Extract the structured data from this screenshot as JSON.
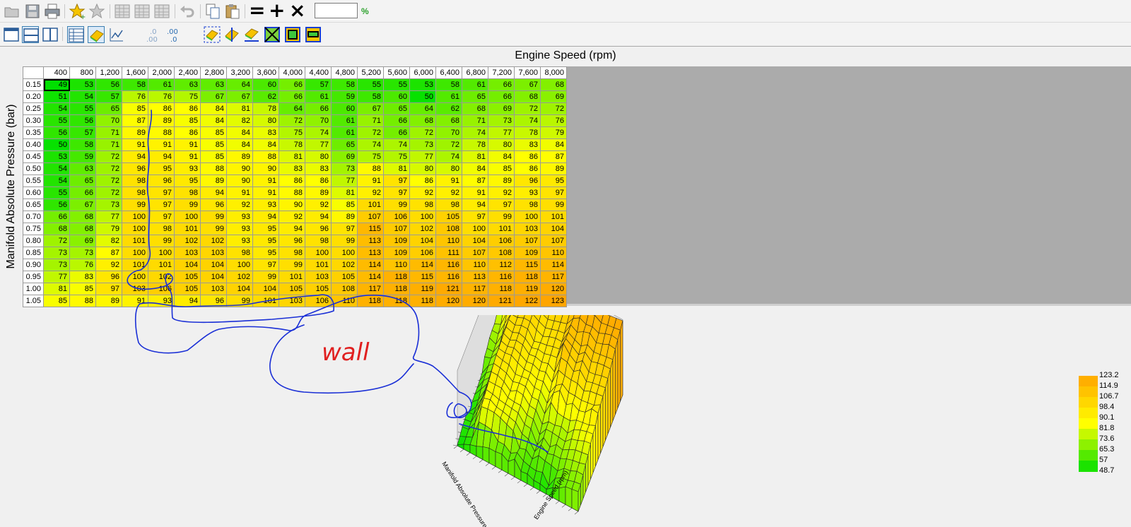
{
  "toolbar": {
    "zoom_value": "",
    "zoom_unit": "%",
    "top_icons": [
      "open-folder-icon",
      "save-icon",
      "print-icon",
      "add-favorite-icon",
      "favorite-icon",
      "table-icon-1",
      "table-icon-2",
      "table-icon-3",
      "undo-icon",
      "copy-icon",
      "paste-icon",
      "equals-icon",
      "plus-icon",
      "multiply-icon"
    ],
    "bottom_icons": [
      "single-pane-icon",
      "split-horizontal-icon",
      "split-vertical-icon",
      "table-view-icon",
      "surface-view-icon",
      "line-graph-icon",
      "decrease-decimals-icon",
      "increase-decimals-icon",
      "fill-selection-icon",
      "fill-right-icon",
      "fill-down-icon",
      "interpolate-icon",
      "interpolate-rows-icon",
      "interpolate-cols-icon"
    ],
    "equals_symbol": "=",
    "plus_symbol": "+",
    "multiply_symbol": "×"
  },
  "table": {
    "x_axis_title": "Engine Speed (rpm)",
    "y_axis_title": "Manifold Absolute Pressure (bar)",
    "columns": [
      "400",
      "800",
      "1,200",
      "1,600",
      "2,000",
      "2,400",
      "2,800",
      "3,200",
      "3,600",
      "4,000",
      "4,400",
      "4,800",
      "5,200",
      "5,600",
      "6,000",
      "6,400",
      "6,800",
      "7,200",
      "7,600",
      "8,000"
    ],
    "rows": [
      {
        "label": "0.15",
        "values": [
          49,
          53,
          56,
          58,
          61,
          63,
          63,
          64,
          60,
          66,
          57,
          58,
          55,
          55,
          53,
          58,
          61,
          66,
          67,
          68
        ]
      },
      {
        "label": "0.20",
        "values": [
          51,
          54,
          57,
          76,
          76,
          75,
          67,
          67,
          62,
          66,
          61,
          59,
          58,
          60,
          50,
          61,
          65,
          66,
          68,
          69
        ]
      },
      {
        "label": "0.25",
        "values": [
          54,
          55,
          65,
          85,
          86,
          86,
          84,
          81,
          78,
          64,
          66,
          60,
          67,
          65,
          64,
          62,
          68,
          69,
          72,
          72
        ]
      },
      {
        "label": "0.30",
        "values": [
          55,
          56,
          70,
          87,
          89,
          85,
          84,
          82,
          80,
          72,
          70,
          61,
          71,
          66,
          68,
          68,
          71,
          73,
          74,
          76
        ]
      },
      {
        "label": "0.35",
        "values": [
          56,
          57,
          71,
          89,
          88,
          86,
          85,
          84,
          83,
          75,
          74,
          61,
          72,
          66,
          72,
          70,
          74,
          77,
          78,
          79
        ]
      },
      {
        "label": "0.40",
        "values": [
          50,
          58,
          71,
          91,
          91,
          91,
          85,
          84,
          84,
          78,
          77,
          65,
          74,
          74,
          73,
          72,
          78,
          80,
          83,
          84
        ]
      },
      {
        "label": "0.45",
        "values": [
          53,
          59,
          72,
          94,
          94,
          91,
          85,
          89,
          88,
          81,
          80,
          69,
          75,
          75,
          77,
          74,
          81,
          84,
          86,
          87
        ]
      },
      {
        "label": "0.50",
        "values": [
          54,
          63,
          72,
          96,
          95,
          93,
          88,
          90,
          90,
          83,
          83,
          73,
          88,
          81,
          80,
          80,
          84,
          85,
          86,
          89
        ]
      },
      {
        "label": "0.55",
        "values": [
          54,
          65,
          72,
          98,
          96,
          95,
          89,
          90,
          91,
          86,
          86,
          77,
          91,
          97,
          86,
          91,
          87,
          89,
          96,
          95
        ]
      },
      {
        "label": "0.60",
        "values": [
          55,
          66,
          72,
          98,
          97,
          98,
          94,
          91,
          91,
          88,
          89,
          81,
          92,
          97,
          92,
          92,
          91,
          92,
          93,
          97
        ]
      },
      {
        "label": "0.65",
        "values": [
          56,
          67,
          73,
          99,
          97,
          99,
          96,
          92,
          93,
          90,
          92,
          85,
          101,
          99,
          98,
          98,
          94,
          97,
          98,
          99
        ]
      },
      {
        "label": "0.70",
        "values": [
          66,
          68,
          77,
          100,
          97,
          100,
          99,
          93,
          94,
          92,
          94,
          89,
          107,
          106,
          100,
          105,
          97,
          99,
          100,
          101
        ]
      },
      {
        "label": "0.75",
        "values": [
          68,
          68,
          79,
          100,
          98,
          101,
          99,
          93,
          95,
          94,
          96,
          97,
          115,
          107,
          102,
          108,
          100,
          101,
          103,
          104
        ]
      },
      {
        "label": "0.80",
        "values": [
          72,
          69,
          82,
          101,
          99,
          102,
          102,
          93,
          95,
          96,
          98,
          99,
          113,
          109,
          104,
          110,
          104,
          106,
          107,
          107
        ]
      },
      {
        "label": "0.85",
        "values": [
          73,
          73,
          87,
          100,
          100,
          103,
          103,
          98,
          95,
          98,
          100,
          100,
          113,
          109,
          106,
          111,
          107,
          108,
          109,
          110
        ]
      },
      {
        "label": "0.90",
        "values": [
          73,
          76,
          92,
          101,
          101,
          104,
          104,
          100,
          97,
          99,
          101,
          102,
          114,
          110,
          114,
          116,
          110,
          112,
          115,
          114
        ]
      },
      {
        "label": "0.95",
        "values": [
          77,
          83,
          96,
          100,
          102,
          105,
          104,
          102,
          99,
          101,
          103,
          105,
          114,
          118,
          115,
          116,
          113,
          116,
          118,
          117
        ]
      },
      {
        "label": "1.00",
        "values": [
          81,
          85,
          97,
          103,
          106,
          105,
          103,
          104,
          104,
          105,
          105,
          108,
          117,
          118,
          119,
          121,
          117,
          118,
          119,
          120
        ]
      },
      {
        "label": "1.05",
        "values": [
          85,
          88,
          89,
          91,
          93,
          94,
          96,
          99,
          101,
          103,
          106,
          110,
          118,
          118,
          118,
          120,
          120,
          121,
          122,
          123
        ]
      }
    ]
  },
  "graph": {
    "x_axis_title": "Engine Speed (rpm)",
    "y_axis_title": "Manifold Absolute Pressure (bar)",
    "legend_values": [
      "123.2",
      "114.9",
      "106.7",
      "98.4",
      "90.1",
      "81.8",
      "73.6",
      "65.3",
      "57",
      "48.7"
    ],
    "low_color": "#00e000",
    "mid_color": "#ffff00",
    "high_color": "#ffa500"
  },
  "annotation": {
    "text": "wall",
    "text_color": "#e02020",
    "stroke_color": "#1a2fd6"
  }
}
